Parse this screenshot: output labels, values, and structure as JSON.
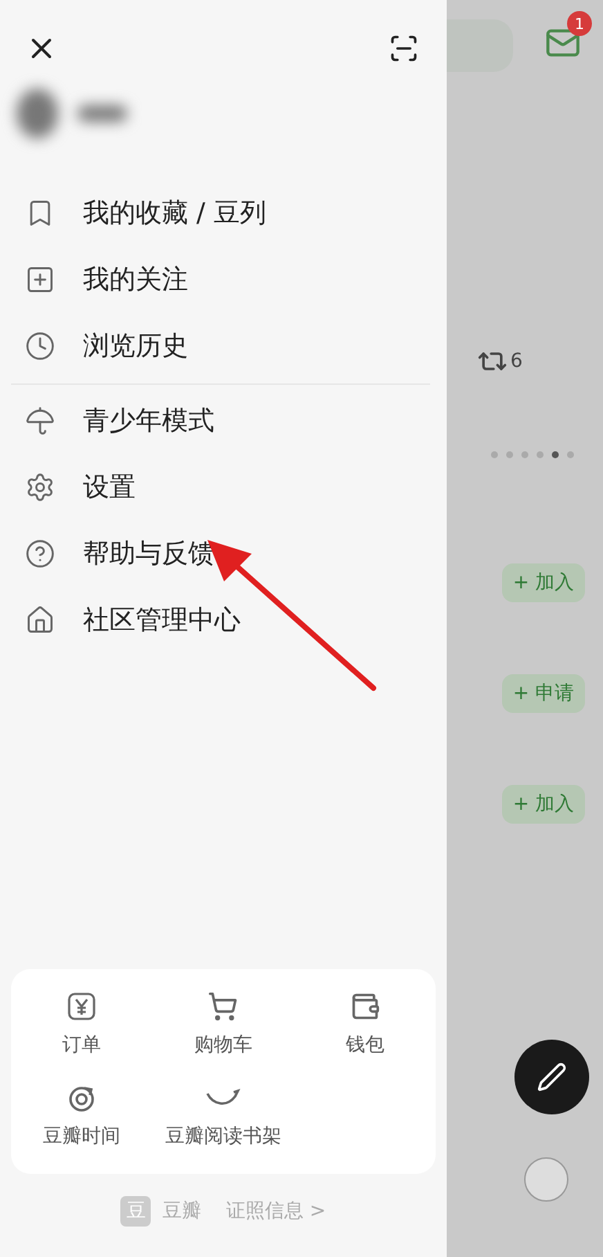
{
  "drawer": {
    "menu_groups": [
      [
        {
          "label": "我的收藏 / 豆列"
        },
        {
          "label": "我的关注"
        },
        {
          "label": "浏览历史"
        }
      ],
      [
        {
          "label": "青少年模式"
        },
        {
          "label": "设置"
        },
        {
          "label": "帮助与反馈"
        },
        {
          "label": "社区管理中心"
        }
      ]
    ],
    "services": [
      {
        "label": "订单"
      },
      {
        "label": "购物车"
      },
      {
        "label": "钱包"
      },
      {
        "label": "豆瓣时间"
      },
      {
        "label": "豆瓣阅读书架"
      }
    ],
    "footer": {
      "logo": "豆",
      "brand": "豆瓣",
      "license_link": "证照信息 >"
    }
  },
  "background": {
    "mail_badge": "1",
    "repost_count": "6",
    "carousel_dots": [
      {
        "selected": false
      },
      {
        "selected": false
      },
      {
        "selected": false
      },
      {
        "selected": false
      },
      {
        "selected": true
      },
      {
        "selected": false
      }
    ],
    "group_buttons": [
      "+ 加入",
      "+ 申请",
      "+ 加入"
    ]
  }
}
